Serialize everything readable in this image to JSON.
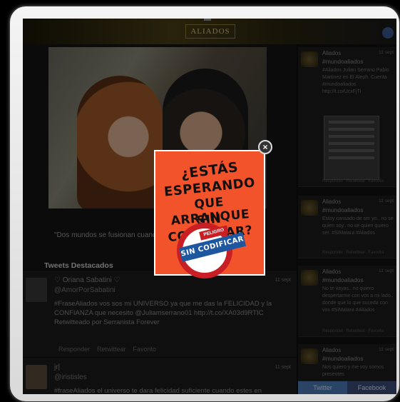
{
  "site": {
    "logo_text": "ALIADOS"
  },
  "video": {
    "caption": "\"Dos mundos se fusionan cuando"
  },
  "tweets_section": {
    "title": "Tweets Destacados"
  },
  "tweets": [
    {
      "name": "♡ Oriana Sabatini ♡",
      "handle": "@AmorPorSabatini",
      "text": "#FraseAliados vos sos mi UNIVERSO ya que me das la FELICIDAD y la CONFIANZA que necesito @Juliamserrano01 http://t.co/XA03d9RTIC",
      "retweet": "Retwitteado por Serranista Forever",
      "time": "11 sept",
      "actions": [
        "Responder",
        "Retwittear",
        "Favorito"
      ]
    },
    {
      "name": "jr|",
      "handle": "@iristisles",
      "text": "#fraseAliados el universo te dara felicidad suficiente cuando estes en confianza contigo mismo",
      "time": "11 sept"
    }
  ],
  "sidebar": {
    "tweets": [
      {
        "name": "Aliados",
        "tag": "#mundoaliados",
        "time": "11 sept",
        "text": "#Aliados Julian Serrano Pablo Martinez en El Aleph. Cuenta #mundoaliados http://t.co/UcxFjTi",
        "actions": [
          "Responder",
          "Retwittear",
          "Favorito"
        ]
      },
      {
        "name": "Aliados",
        "tag": "#mundoaliados",
        "time": "11 sept",
        "text": "Estoy cansado de ser yo.. no se quien soy.. no se quien quiero ser. #SiMatara #Aliados",
        "actions": [
          "Responder",
          "Retwittear",
          "Favorito"
        ]
      },
      {
        "name": "Aliados",
        "tag": "#mundoaliados",
        "time": "11 sept",
        "text": "No te vayas.. no quiero despertarme con vos a mi lado.. donde que lo que suceda con vos #SiMatara #Aliados",
        "actions": [
          "Responder",
          "Retwittear",
          "Favorito"
        ]
      },
      {
        "name": "Aliados",
        "tag": "#mundoaliados",
        "time": "11 sept",
        "text": "Nos quiero y me voy somos presentes"
      }
    ],
    "share_twitter": "Twitter",
    "share_facebook": "Facebook"
  },
  "popup": {
    "line1": "¿ESTÁS",
    "line2": "ESPERANDO",
    "line3": "QUE ARRANQUE",
    "line4": "SIN CODIFICAR?",
    "stamp_top": "PELIGRO",
    "stamp_band": "SIN CODIFICAR",
    "close_glyph": "×"
  },
  "colors": {
    "popup_bg": "#f2532a",
    "stamp_red": "#c91f24",
    "stamp_blue": "#1e57a0",
    "twitter_blue": "#4e7cb8",
    "facebook_blue": "#3b4f7a"
  }
}
